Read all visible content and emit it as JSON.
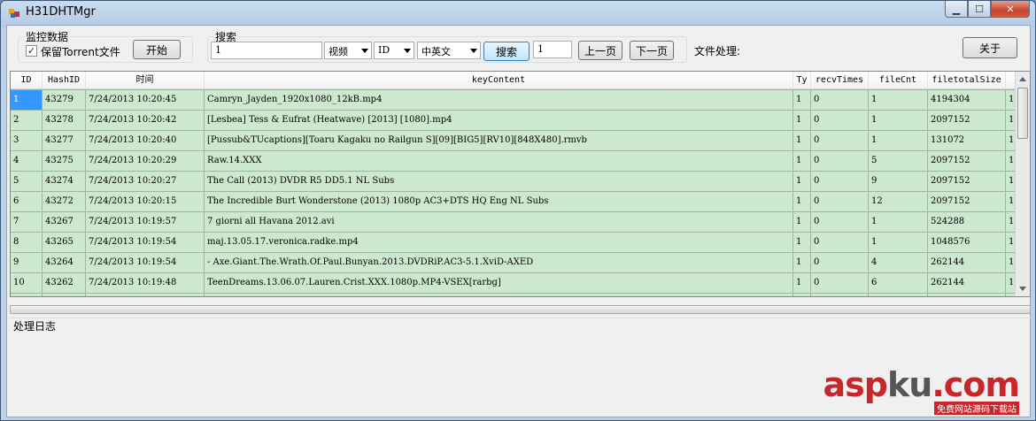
{
  "window": {
    "title": "H31DHTMgr",
    "controls": {
      "minimize": "▁",
      "maximize": "☐",
      "close": "✕"
    }
  },
  "monitor": {
    "legend": "监控数据",
    "keep_torrent_label": "保留Torrent文件",
    "keep_torrent_checked": true,
    "start_button": "开始"
  },
  "search": {
    "legend": "搜索",
    "keyword_value": "1",
    "type_select": "视频",
    "field_select": "ID",
    "language_select": "中英文",
    "search_button": "搜索",
    "page_value": "1",
    "prev_button": "上一页",
    "next_button": "下一页"
  },
  "file_processing_label": "文件处理:",
  "about_button": "关于",
  "grid": {
    "columns": [
      "ID",
      "HashID",
      "时间",
      "keyContent",
      "Ty",
      "recvTimes",
      "fileCnt",
      "filetotalSize",
      ""
    ],
    "rows": [
      [
        "1",
        "43279",
        "7/24/2013 10:20:45",
        "Camryn_Jayden_1920x1080_12kB.mp4",
        "1",
        "0",
        "1",
        "4194304",
        "1"
      ],
      [
        "2",
        "43278",
        "7/24/2013 10:20:42",
        "[Lesbea] Tess & Eufrat (Heatwave) [2013] [1080].mp4",
        "1",
        "0",
        "1",
        "2097152",
        "1"
      ],
      [
        "3",
        "43277",
        "7/24/2013 10:20:40",
        "[Pussub&TUcaptions][Toaru Kagaku no Railgun S][09][BIG5][RV10][848X480].rmvb",
        "1",
        "0",
        "1",
        "131072",
        "1"
      ],
      [
        "4",
        "43275",
        "7/24/2013 10:20:29",
        "Raw.14.XXX",
        "1",
        "0",
        "5",
        "2097152",
        "1"
      ],
      [
        "5",
        "43274",
        "7/24/2013 10:20:27",
        "The Call (2013) DVDR R5 DD5.1 NL Subs",
        "1",
        "0",
        "9",
        "2097152",
        "1"
      ],
      [
        "6",
        "43272",
        "7/24/2013 10:20:15",
        "The Incredible Burt Wonderstone (2013) 1080p AC3+DTS HQ Eng NL Subs",
        "1",
        "0",
        "12",
        "2097152",
        "1"
      ],
      [
        "7",
        "43267",
        "7/24/2013 10:19:57",
        "7 giorni all Havana 2012.avi",
        "1",
        "0",
        "1",
        "524288",
        "1"
      ],
      [
        "8",
        "43265",
        "7/24/2013 10:19:54",
        "maj.13.05.17.veronica.radke.mp4",
        "1",
        "0",
        "1",
        "1048576",
        "1"
      ],
      [
        "9",
        "43264",
        "7/24/2013 10:19:54",
        "- Axe.Giant.The.Wrath.Of.Paul.Bunyan.2013.DVDRiP.AC3-5.1.XviD-AXED",
        "1",
        "0",
        "4",
        "262144",
        "1"
      ],
      [
        "10",
        "43262",
        "7/24/2013 10:19:48",
        "TeenDreams.13.06.07.Lauren.Crist.XXX.1080p.MP4-VSEX[rarbg]",
        "1",
        "0",
        "6",
        "262144",
        "1"
      ],
      [
        "",
        "",
        "",
        "",
        "",
        "",
        "",
        "",
        ""
      ]
    ]
  },
  "log": {
    "legend": "处理日志"
  },
  "watermark": {
    "logo_a": "asp",
    "logo_b": "ku",
    "logo_c": ".com",
    "sub": "免费网站源码下载站"
  },
  "colors": {
    "row_bg": "#cce8cf",
    "selected": "#3399ff",
    "window_frame": "#b5cbe4"
  }
}
